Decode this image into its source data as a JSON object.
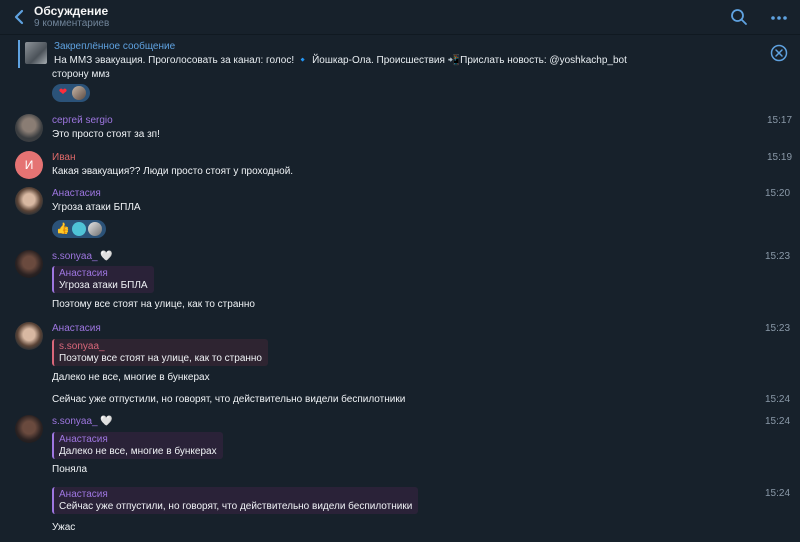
{
  "header": {
    "title": "Обсуждение",
    "subtitle": "9 комментариев"
  },
  "pinned": {
    "title": "Закреплённое сообщение",
    "text": "На ММЗ эвакуация.  Проголосовать за канал: голос!  🔹 Йошкар-Ола. Происшествия  📲Прислать новость: @yoshkachp_bot",
    "continuation": "сторону ммз"
  },
  "colors": {
    "background": "#17212b",
    "accent": "#5fa2e0",
    "name_purple": "#9e76e0",
    "name_red": "#e06a6a"
  },
  "messages": [
    {
      "name": "сергей sergio",
      "text": "Это просто стоят за зп!",
      "time": "15:17"
    },
    {
      "name": "Иван",
      "avatar_letter": "И",
      "text": "Какая эвакуация?? Люди просто стоят у проходной.",
      "time": "15:19"
    },
    {
      "name": "Анастасия",
      "text": "Угроза атаки БПЛА",
      "time": "15:20"
    },
    {
      "name": "s.sonyaa_ 🤍",
      "quote_name": "Анастасия",
      "quote_text": "Угроза атаки БПЛА",
      "text": "Поэтому все стоят на улице, как то странно",
      "time": "15:23"
    },
    {
      "name": "Анастасия",
      "quote_name": "s.sonyaa_",
      "quote_text": "Поэтому все стоят на улице, как то странно",
      "text": "Далеко не все, многие в бункерах",
      "time": "15:23"
    },
    {
      "text": "Сейчас уже отпустили, но говорят, что действительно видели беспилотники",
      "time": "15:24"
    },
    {
      "name": "s.sonyaa_ 🤍",
      "quote_name": "Анастасия",
      "quote_text": "Далеко не все, многие в бункерах",
      "text": "Поняла",
      "time": "15:24"
    },
    {
      "quote_name": "Анастасия",
      "quote_text": "Сейчас уже отпустили, но говорят, что действительно видели беспилотники",
      "text": "Ужас",
      "time": "15:24"
    }
  ],
  "reactions": {
    "pinned": [
      "heart",
      "avatar"
    ],
    "msg3": [
      "thumbs-up",
      "avatar",
      "avatar"
    ]
  }
}
